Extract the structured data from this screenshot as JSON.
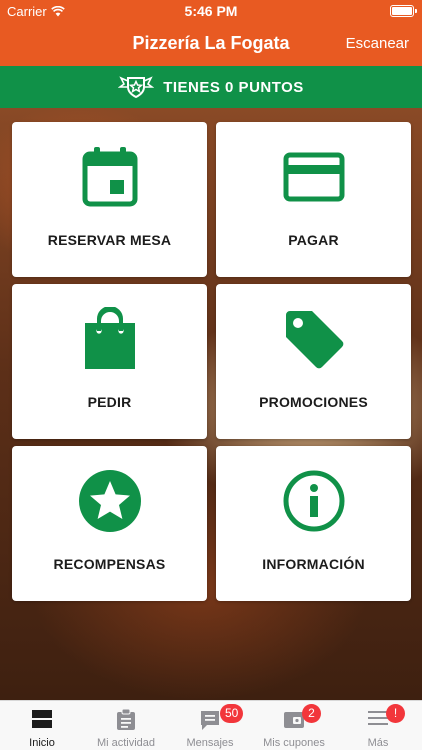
{
  "status_bar": {
    "carrier": "Carrier",
    "time": "5:46 PM"
  },
  "nav": {
    "title": "Pizzería La Fogata",
    "scan_label": "Escanear"
  },
  "points_banner": {
    "label": "TIENES 0 PUNTOS",
    "icon": "badge-star-icon"
  },
  "colors": {
    "brand_orange": "#e85a22",
    "brand_green": "#109148",
    "badge_red": "#f2363b"
  },
  "tiles": [
    {
      "label": "RESERVAR MESA",
      "icon": "calendar-icon"
    },
    {
      "label": "PAGAR",
      "icon": "credit-card-icon"
    },
    {
      "label": "PEDIR",
      "icon": "shopping-bag-icon"
    },
    {
      "label": "PROMOCIONES",
      "icon": "price-tag-icon"
    },
    {
      "label": "RECOMPENSAS",
      "icon": "star-icon"
    },
    {
      "label": "INFORMACIÓN",
      "icon": "info-icon"
    }
  ],
  "tabbar": [
    {
      "label": "Inicio",
      "icon": "home-icon",
      "active": true,
      "badge": ""
    },
    {
      "label": "Mi actividad",
      "icon": "clipboard-icon",
      "active": false,
      "badge": ""
    },
    {
      "label": "Mensajes",
      "icon": "chat-icon",
      "active": false,
      "badge": "50"
    },
    {
      "label": "Mis cupones",
      "icon": "wallet-icon",
      "active": false,
      "badge": "2"
    },
    {
      "label": "Más",
      "icon": "menu-icon",
      "active": false,
      "badge": "!"
    }
  ]
}
